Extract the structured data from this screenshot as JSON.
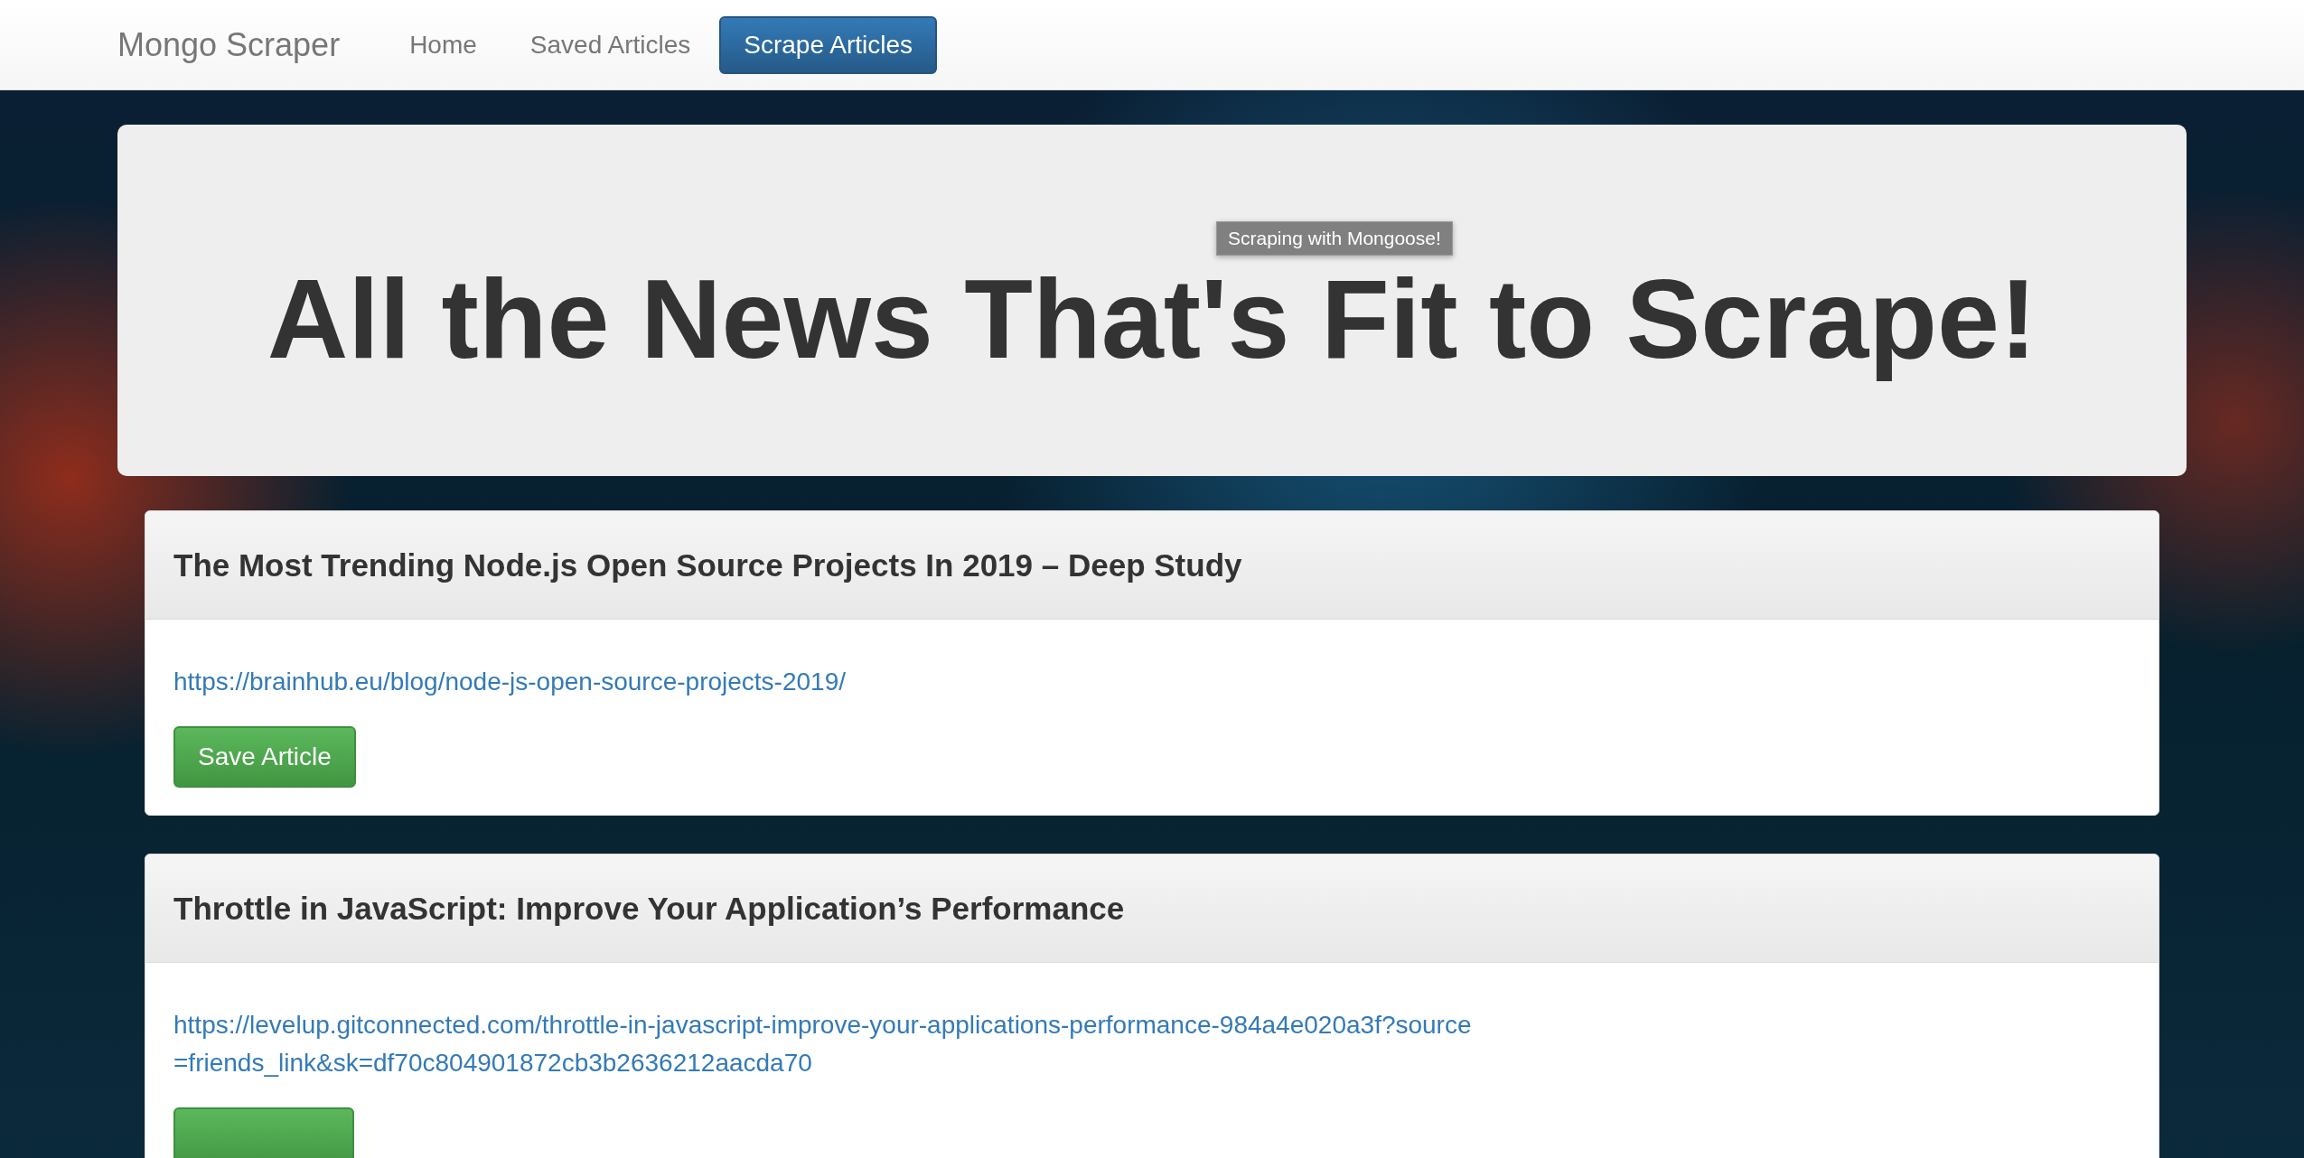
{
  "navbar": {
    "brand": "Mongo Scraper",
    "items": [
      {
        "label": "Home",
        "selected": false
      },
      {
        "label": "Saved Articles",
        "selected": false
      },
      {
        "label": "Scrape Articles",
        "selected": true
      }
    ]
  },
  "jumbotron": {
    "tooltip": "Scraping with Mongoose!",
    "heading": "All the News That's Fit to Scrape!"
  },
  "articles": [
    {
      "title": "The Most Trending Node.js Open Source Projects In 2019 – Deep Study",
      "link": "https://brainhub.eu/blog/node-js-open-source-projects-2019/",
      "button": "Save Article"
    },
    {
      "title": "Throttle in JavaScript: Improve Your Application’s Performance",
      "link": "https://levelup.gitconnected.com/throttle-in-javascript-improve-your-applications-performance-984a4e020a3f?source=friends_link&sk=df70c804901872cb3b2636212aacda70"
    }
  ]
}
